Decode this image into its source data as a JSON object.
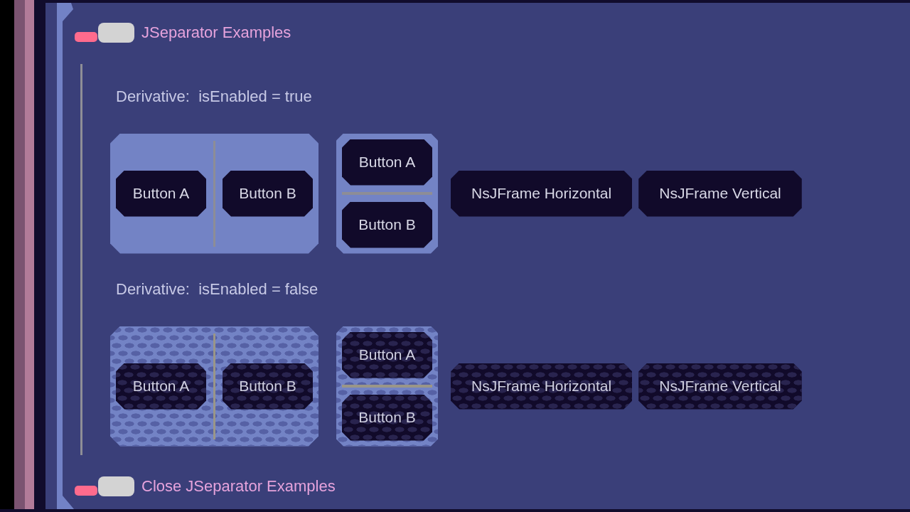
{
  "section": {
    "title": "JSeparator Examples",
    "close_label": "Close JSeparator Examples"
  },
  "groups": [
    {
      "label": "Derivative:  isEnabled = true",
      "disabled": false,
      "items": [
        {
          "kind": "side_by_side",
          "buttons": [
            "Button A",
            "Button B"
          ]
        },
        {
          "kind": "stacked",
          "buttons": [
            "Button A",
            "Button B"
          ]
        },
        {
          "kind": "button",
          "label": "NsJFrame Horizontal"
        },
        {
          "kind": "button",
          "label": "NsJFrame Vertical"
        }
      ]
    },
    {
      "label": "Derivative:  isEnabled = false",
      "disabled": true,
      "items": [
        {
          "kind": "side_by_side",
          "buttons": [
            "Button A",
            "Button B"
          ]
        },
        {
          "kind": "stacked",
          "buttons": [
            "Button A",
            "Button B"
          ]
        },
        {
          "kind": "button",
          "label": "NsJFrame Horizontal"
        },
        {
          "kind": "button",
          "label": "NsJFrame Vertical"
        }
      ]
    }
  ]
}
